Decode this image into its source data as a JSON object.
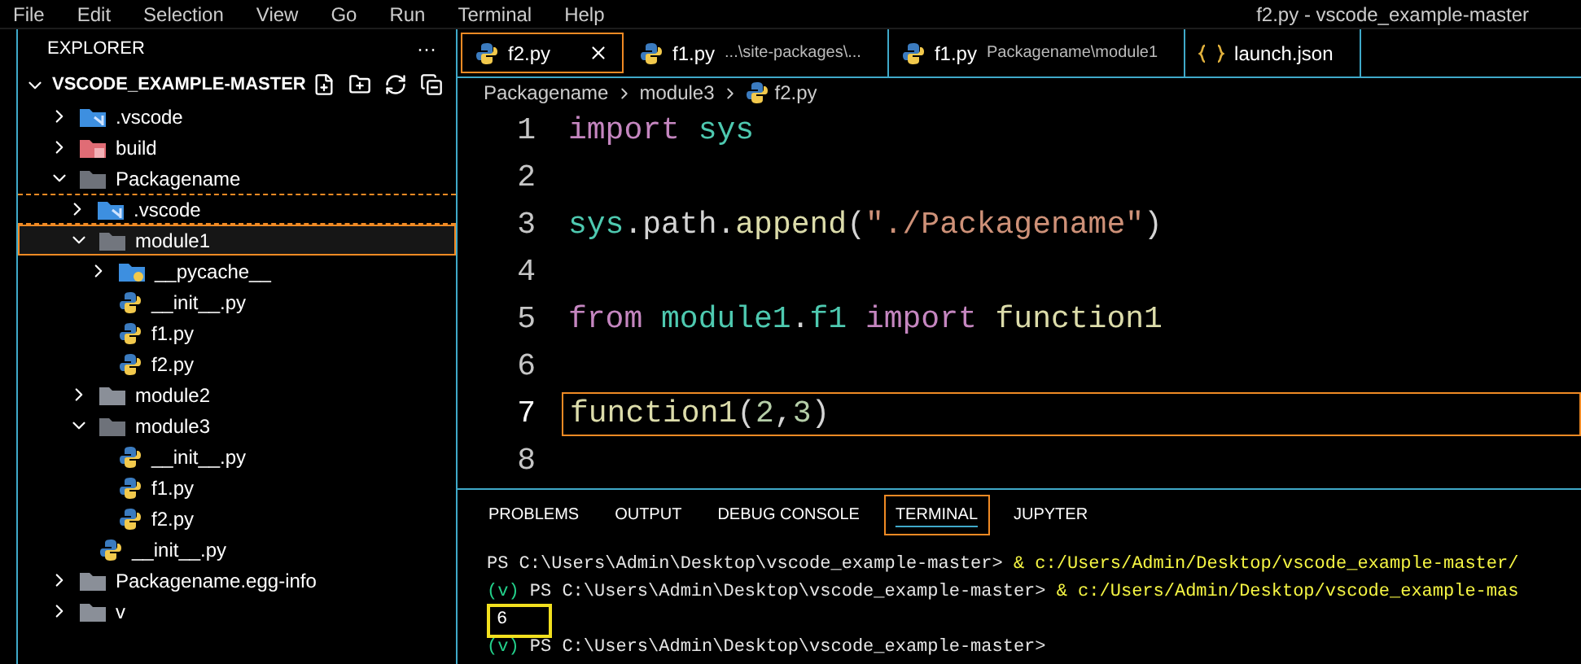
{
  "menu_bar": {
    "items": [
      "File",
      "Edit",
      "Selection",
      "View",
      "Go",
      "Run",
      "Terminal",
      "Help"
    ],
    "title": "f2.py - vscode_example-master"
  },
  "explorer": {
    "title": "EXPLORER",
    "more": "···",
    "root": {
      "label": "VSCODE_EXAMPLE-MASTER",
      "expanded": true
    },
    "tree": [
      {
        "label": ".vscode",
        "kind": "folder-vscode",
        "expanded": false,
        "selected": false,
        "focused": false
      },
      {
        "label": "build",
        "kind": "folder-build",
        "expanded": false,
        "selected": false,
        "focused": false
      },
      {
        "label": "Packagename",
        "kind": "folder",
        "expanded": true,
        "selected": false,
        "focused": false,
        "children": [
          {
            "label": ".vscode",
            "kind": "folder-vscode",
            "expanded": false,
            "selected": false,
            "focused": true
          },
          {
            "label": "module1",
            "kind": "folder",
            "expanded": true,
            "selected": true,
            "focused": false,
            "children": [
              {
                "label": "__pycache__",
                "kind": "folder-python",
                "expanded": false,
                "selected": false,
                "focused": false
              },
              {
                "label": "__init__.py",
                "kind": "python",
                "selected": false,
                "focused": false
              },
              {
                "label": "f1.py",
                "kind": "python",
                "selected": false,
                "focused": false
              },
              {
                "label": "f2.py",
                "kind": "python",
                "selected": false,
                "focused": false
              }
            ]
          },
          {
            "label": "module2",
            "kind": "folder",
            "expanded": false,
            "selected": false,
            "focused": false
          },
          {
            "label": "module3",
            "kind": "folder",
            "expanded": true,
            "selected": false,
            "focused": false,
            "children": [
              {
                "label": "__init__.py",
                "kind": "python",
                "selected": false,
                "focused": false
              },
              {
                "label": "f1.py",
                "kind": "python",
                "selected": false,
                "focused": false
              },
              {
                "label": "f2.py",
                "kind": "python",
                "selected": false,
                "focused": false
              }
            ]
          },
          {
            "label": "__init__.py",
            "kind": "python",
            "selected": false,
            "focused": false
          }
        ]
      },
      {
        "label": "Packagename.egg-info",
        "kind": "folder",
        "expanded": false,
        "selected": false,
        "focused": false
      },
      {
        "label": "v",
        "kind": "folder",
        "expanded": false,
        "selected": false,
        "focused": false
      }
    ]
  },
  "editor_tabs": [
    {
      "label": "f2.py",
      "kind": "python",
      "selected": true
    },
    {
      "label": "f1.py",
      "description": "...\\site-packages\\...",
      "kind": "python",
      "selected": false
    },
    {
      "label": "f1.py",
      "description": "Packagename\\module1",
      "kind": "python",
      "selected": false
    },
    {
      "label": "launch.json",
      "kind": "json",
      "selected": false
    }
  ],
  "breadcrumb": [
    {
      "label": "Packagename",
      "kind": "folder"
    },
    {
      "label": "module3",
      "kind": "folder"
    },
    {
      "label": "f2.py",
      "kind": "python"
    }
  ],
  "code": [
    {
      "number": "1",
      "current": false,
      "tokens": [
        {
          "kind": "keyword",
          "text": "import "
        },
        {
          "kind": "module",
          "text": "sys"
        }
      ]
    },
    {
      "number": "2",
      "current": false
    },
    {
      "number": "3",
      "current": false,
      "tokens": [
        {
          "kind": "module",
          "text": "sys"
        },
        {
          "kind": "plain",
          "text": ".path."
        },
        {
          "kind": "func",
          "text": "append"
        },
        {
          "kind": "plain",
          "text": "("
        },
        {
          "kind": "string",
          "text": "\"./Packagename\""
        },
        {
          "kind": "plain",
          "text": ")"
        }
      ]
    },
    {
      "number": "4",
      "current": false
    },
    {
      "number": "5",
      "current": false,
      "tokens": [
        {
          "kind": "keyword",
          "text": "from "
        },
        {
          "kind": "module",
          "text": "module1"
        },
        {
          "kind": "plain",
          "text": "."
        },
        {
          "kind": "module",
          "text": "f1"
        },
        {
          "kind": "keyword",
          "text": " import "
        },
        {
          "kind": "func",
          "text": "function1"
        }
      ]
    },
    {
      "number": "6",
      "current": false
    },
    {
      "number": "7",
      "current": true,
      "tokens": [
        {
          "kind": "func",
          "text": "function1"
        },
        {
          "kind": "plain",
          "text": "("
        },
        {
          "kind": "number",
          "text": "2"
        },
        {
          "kind": "plain",
          "text": ","
        },
        {
          "kind": "number",
          "text": "3"
        },
        {
          "kind": "plain",
          "text": ")"
        }
      ]
    },
    {
      "number": "8",
      "current": false
    }
  ],
  "panel_tabs": [
    {
      "label": "PROBLEMS",
      "selected": false
    },
    {
      "label": "OUTPUT",
      "selected": false
    },
    {
      "label": "DEBUG CONSOLE",
      "selected": false
    },
    {
      "label": "TERMINAL",
      "selected": true
    },
    {
      "label": "JUPYTER",
      "selected": false
    }
  ],
  "terminal": [
    {
      "kind": "prompt",
      "prompt": "PS C:\\Users\\Admin\\Desktop\\vscode_example-master> ",
      "command": "& c:/Users/Admin/Desktop/vscode_example-master/"
    },
    {
      "kind": "prompt",
      "env": "(v) ",
      "prompt": "PS C:\\Users\\Admin\\Desktop\\vscode_example-master> ",
      "command": "& c:/Users/Admin/Desktop/vscode_example-mas"
    },
    {
      "kind": "output",
      "text": "6",
      "highlighted": true
    },
    {
      "kind": "prompt",
      "env": "(v) ",
      "prompt": "PS C:\\Users\\Admin\\Desktop\\vscode_example-master>"
    }
  ]
}
